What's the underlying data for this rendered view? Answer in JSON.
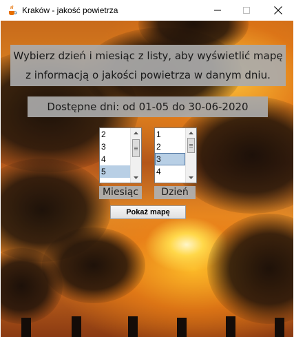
{
  "window": {
    "title": "Kraków - jakość powietrza",
    "app_icon": "java-cup-icon",
    "controls": [
      "minimize-icon",
      "maximize-icon",
      "close-icon"
    ]
  },
  "info": {
    "line1": "Wybierz dzień i miesiąc z listy, aby wyświetlić mapę",
    "line2": "z informacją o jakości powietrza w danym dniu.",
    "available_dates": "Dostępne dni: od 01-05 do 30-06-2020"
  },
  "month_list": {
    "label": "Miesiąc",
    "visible_items": [
      "2",
      "3",
      "4",
      "5"
    ],
    "selected": "5"
  },
  "day_list": {
    "label": "Dzień",
    "visible_items": [
      "1",
      "2",
      "3",
      "4"
    ],
    "selected": "3"
  },
  "show_button": {
    "label": "Pokaż mapę"
  },
  "colors": {
    "panel_bg": "#aaaaaa",
    "selection": "#b8cfe5",
    "sky_orange": "#e08a24",
    "smoke": "#140c08"
  }
}
